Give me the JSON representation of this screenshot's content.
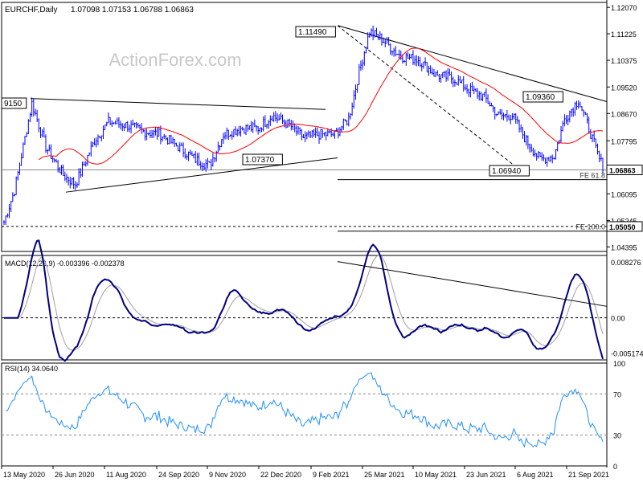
{
  "header": {
    "symbol": "EURCHF,Daily",
    "ohlc": "1.07098 1.07153 1.06788 1.06863"
  },
  "watermark": "ActionForex.com",
  "colors": {
    "price": "#0000ff",
    "ma": "#ff0000",
    "macd": "#000080",
    "macd_signal": "#a0a0a0",
    "rsi": "#1e90ff",
    "lines": "#000000",
    "grid": "#000000"
  },
  "chart_data": [
    {
      "type": "candlestick",
      "title": "EURCHF,Daily",
      "y_ticks": [
        "1.12070",
        "1.11225",
        "1.10375",
        "1.09520",
        "1.08670",
        "1.07795",
        "1.06863",
        "1.06095",
        "1.05245",
        "1.05050",
        "1.04395"
      ],
      "ylim": [
        1.0425,
        1.1223
      ],
      "current_price": 1.06863,
      "current_label": "1.06863",
      "ma_label": "1.05050",
      "price_labels": [
        {
          "text": "1.11490",
          "value": 1.1149
        },
        {
          "text": "1.09360",
          "value": 1.0936
        },
        {
          "text": "1.07370",
          "value": 1.0737
        },
        {
          "text": "1.06940",
          "value": 1.0694
        },
        {
          "text": "9150",
          "value": 1.0915
        }
      ],
      "fe_levels": [
        {
          "label": "FE 61.8",
          "value": 1.0655
        },
        {
          "label": "FE 100.0",
          "value": 1.049
        }
      ],
      "horizontal_level": 1.0505
    },
    {
      "type": "line",
      "title": "MACD(12,26,9) -0.003396 -0.002378",
      "y_ticks": [
        "0.008276",
        "0.00",
        "-0.005174"
      ],
      "ylim": [
        -0.0062,
        0.0092
      ]
    },
    {
      "type": "line",
      "title": "RSI(14) 34.0640",
      "y_ticks": [
        "100",
        "70",
        "30",
        "0"
      ],
      "ylim": [
        0,
        100
      ],
      "levels": [
        70,
        30
      ]
    }
  ],
  "x_ticks": [
    "13 May 2020",
    "26 Jun 2020",
    "11 Aug 2020",
    "24 Sep 2020",
    "9 Nov 2020",
    "22 Dec 2020",
    "9 Feb 2021",
    "25 Mar 2021",
    "10 May 2021",
    "23 Jun 2021",
    "6 Aug 2021",
    "21 Sep 2021"
  ]
}
